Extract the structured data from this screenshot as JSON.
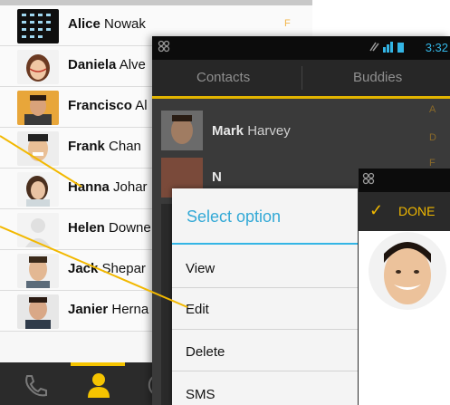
{
  "contacts": [
    {
      "first": "Alice",
      "last": "Nowak",
      "index_letter": "F"
    },
    {
      "first": "Daniela",
      "last": "Alve",
      "index_letter": ""
    },
    {
      "first": "Francisco",
      "last": "Al",
      "index_letter": ""
    },
    {
      "first": "Frank",
      "last": "Chan",
      "index_letter": ""
    },
    {
      "first": "Hanna",
      "last": "Johar",
      "index_letter": ""
    },
    {
      "first": "Helen",
      "last": "Downe",
      "index_letter": ""
    },
    {
      "first": "Jack",
      "last": "Shepar",
      "index_letter": ""
    },
    {
      "first": "Janier",
      "last": "Herna",
      "index_letter": ""
    }
  ],
  "phone": {
    "time": "3:32",
    "tabs": [
      "Contacts",
      "Buddies"
    ],
    "rows": [
      {
        "first": "Mark",
        "last": "Harvey"
      },
      {
        "first": "N",
        "last": ""
      }
    ],
    "alpha": [
      "A",
      "D",
      "F"
    ]
  },
  "dialog": {
    "title": "Select option",
    "options": [
      "View",
      "Edit",
      "Delete",
      "SMS"
    ]
  },
  "edit": {
    "done_label": "DONE"
  },
  "colors": {
    "accent_yellow": "#f5c400",
    "holo_blue": "#33b5e5"
  }
}
